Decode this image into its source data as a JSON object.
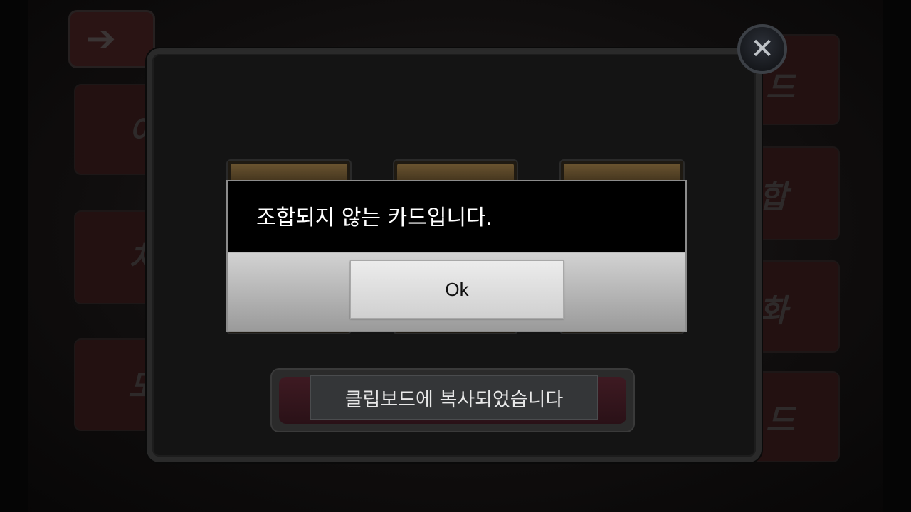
{
  "dialog": {
    "message": "조합되지 않는 카드입니다.",
    "ok_label": "Ok"
  },
  "toast": {
    "message": "클립보드에 복사되었습니다"
  },
  "background_menu": {
    "left_glyphs": [
      "이",
      "치",
      "도"
    ],
    "right_glyphs": [
      "드",
      "합",
      "화",
      "드"
    ]
  },
  "icons": {
    "back": "back-arrow-icon",
    "close": "close-icon"
  },
  "colors": {
    "dialog_bg": "#000000",
    "dialog_button_area": "#bcbcbc",
    "toast_bg": "#343638",
    "panel_border": "#2a2a2a"
  }
}
